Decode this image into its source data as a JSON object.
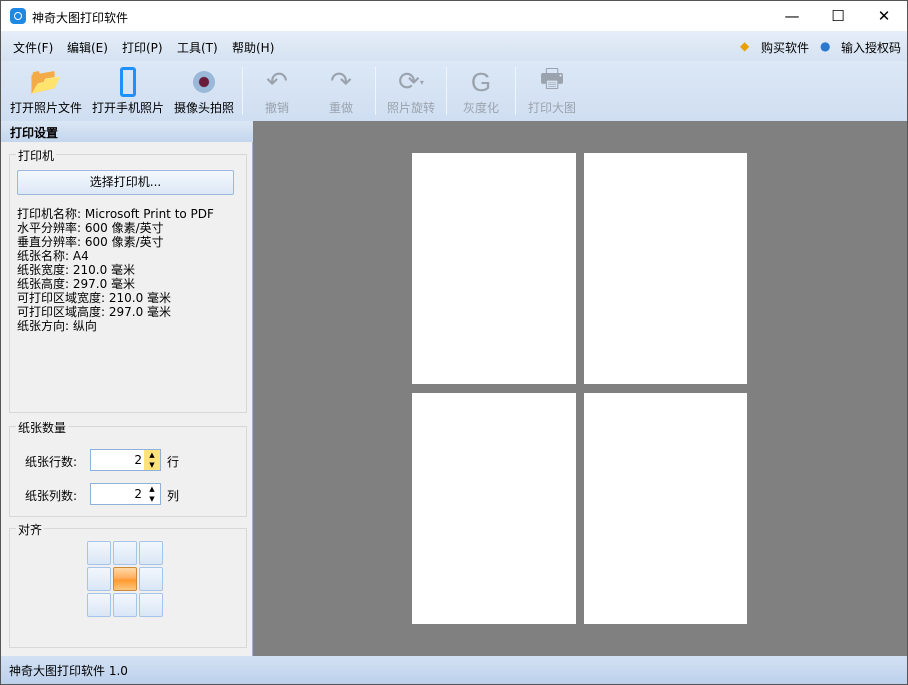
{
  "window": {
    "title": "神奇大图打印软件",
    "minimize": "—",
    "maximize": "☐",
    "close": "✕"
  },
  "menu": [
    "文件(F)",
    "编辑(E)",
    "打印(P)",
    "工具(T)",
    "帮助(H)"
  ],
  "menu_right": {
    "buy": "购买软件",
    "license": "输入授权码"
  },
  "toolbar": [
    {
      "label": "打开照片文件",
      "icon": "open-folder-icon",
      "enabled": true
    },
    {
      "label": "打开手机照片",
      "icon": "phone-icon",
      "enabled": true
    },
    {
      "label": "摄像头拍照",
      "icon": "webcam-icon",
      "enabled": true
    },
    {
      "label": "撤销",
      "icon": "undo-icon",
      "enabled": false
    },
    {
      "label": "重做",
      "icon": "redo-icon",
      "enabled": false
    },
    {
      "label": "照片旋转",
      "icon": "rotate-icon",
      "enabled": false
    },
    {
      "label": "灰度化",
      "icon": "grayscale-icon",
      "enabled": false
    },
    {
      "label": "打印大图",
      "icon": "printer-icon",
      "enabled": false
    }
  ],
  "panel": {
    "title": "打印设置",
    "printer_group": "打印机",
    "select_printer": "选择打印机...",
    "info": [
      "打印机名称: Microsoft Print to PDF",
      "水平分辨率: 600 像素/英寸",
      "垂直分辨率: 600 像素/英寸",
      "纸张名称: A4",
      "纸张宽度: 210.0 毫米",
      "纸张高度: 297.0 毫米",
      "可打印区域宽度: 210.0 毫米",
      "可打印区域高度: 297.0 毫米",
      "纸张方向: 纵向"
    ],
    "paper_group": "纸张数量",
    "rows_label": "纸张行数:",
    "rows_value": "2",
    "rows_unit": "行",
    "cols_label": "纸张列数:",
    "cols_value": "2",
    "cols_unit": "列",
    "align_group": "对齐",
    "align_selected": "center"
  },
  "status": "神奇大图打印软件 1.0"
}
